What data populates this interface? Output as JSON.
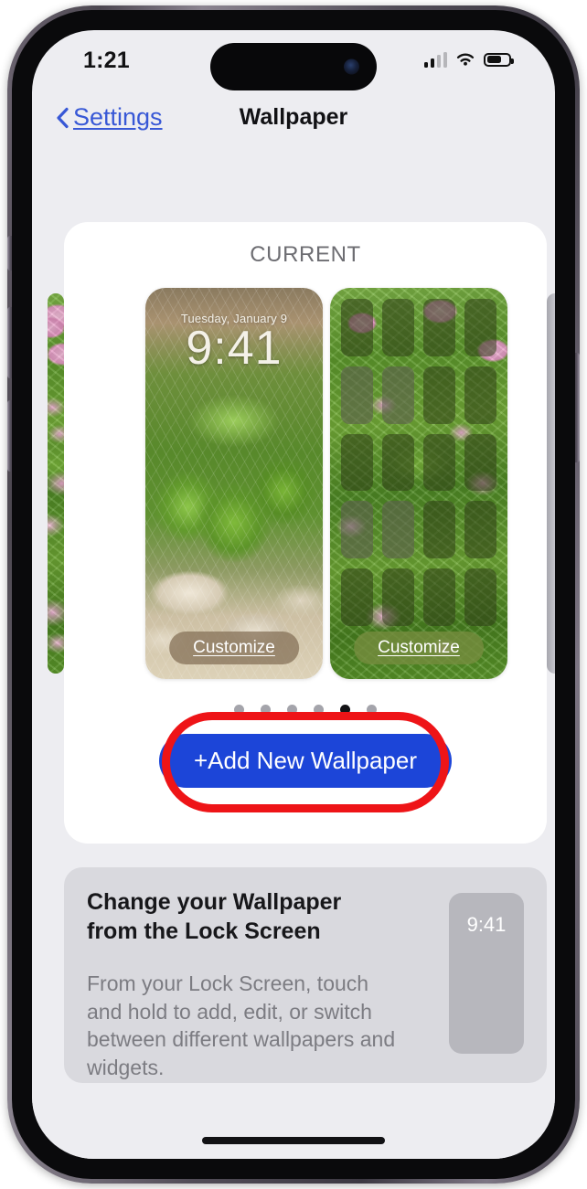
{
  "status_bar": {
    "time": "1:21",
    "signal_icon": "cellular-signal-icon",
    "wifi_icon": "wifi-icon",
    "battery_icon": "battery-icon",
    "battery_level_percent": 60
  },
  "nav": {
    "back_label": "Settings",
    "back_icon": "chevron-left-icon",
    "title": "Wallpaper"
  },
  "current_section": {
    "header": "CURRENT",
    "lock_screen": {
      "date": "Tuesday, January 9",
      "time": "9:41",
      "customize_label": "Customize"
    },
    "home_screen": {
      "customize_label": "Customize"
    },
    "page_dots": {
      "count": 6,
      "active_index": 4
    },
    "add_wallpaper_label": "+Add New Wallpaper"
  },
  "info_card": {
    "title": "Change your Wallpaper from the Lock Screen",
    "body": "From your Lock Screen, touch and hold to add, edit, or switch between different wallpapers and widgets.",
    "thumbnail_time": "9:41"
  },
  "annotation": {
    "shape": "red-oval-highlight",
    "target": "add-new-wallpaper-button",
    "color": "#ee1417"
  },
  "colors": {
    "accent_blue": "#1c45d8",
    "link_blue": "#3858d6",
    "screen_background": "#ededf1",
    "card_white": "#ffffff",
    "info_card_gray": "#d9d9de",
    "label_gray": "#6d6d72"
  }
}
